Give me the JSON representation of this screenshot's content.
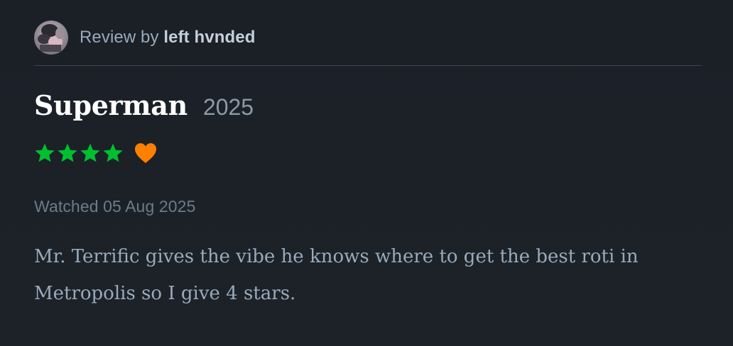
{
  "review": {
    "prefix": "Review by ",
    "username": "left hvnded",
    "avatar_icon": "user-avatar-icon"
  },
  "film": {
    "title": "Superman",
    "year": "2025"
  },
  "rating": {
    "stars": 4,
    "max_stars": 5,
    "star_color": "#00c030",
    "liked": true,
    "heart_color": "#ff8000"
  },
  "watched": {
    "text": "Watched 05 Aug 2025"
  },
  "body": {
    "text": "Mr. Terrific gives the vibe he knows where to get the best roti in Metropolis so I give 4 stars."
  },
  "colors": {
    "background": "#1c2128",
    "divider": "#3b4653",
    "title": "#ffffff",
    "muted": "#99aabb"
  }
}
